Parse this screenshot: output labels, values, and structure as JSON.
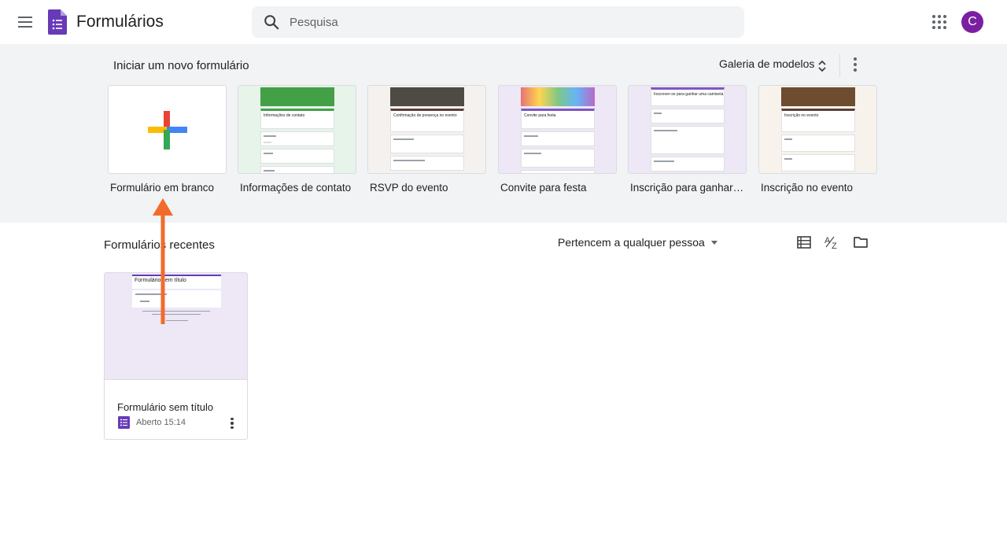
{
  "app": {
    "title": "Formulários",
    "accent": "#673ab7",
    "avatar_letter": "C",
    "avatar_color": "#7b1fa2"
  },
  "search": {
    "placeholder": "Pesquisa"
  },
  "gallery": {
    "heading": "Iniciar um novo formulário",
    "gallery_link": "Galeria de modelos",
    "templates": [
      {
        "label": "Formulário em branco"
      },
      {
        "label": "Informações de contato",
        "form_title": "Informações de contato"
      },
      {
        "label": "RSVP do evento",
        "form_title": "Confirmação de presença no evento"
      },
      {
        "label": "Convite para festa",
        "form_title": "Convite para festa"
      },
      {
        "label": "Inscrição para ganhar camiseta",
        "form_title": "Inscrever-se para ganhar uma camiseta"
      },
      {
        "label": "Inscrição no evento",
        "form_title": "Inscrição no evento"
      }
    ]
  },
  "recent": {
    "heading": "Formulários recentes",
    "owner_filter": "Pertencem a qualquer pessoa",
    "documents": [
      {
        "title": "Formulário sem título",
        "thumb_title": "Formulário sem título",
        "meta": "Aberto 15:14"
      }
    ]
  },
  "annotation": {
    "arrow_color": "#f26b2a"
  }
}
